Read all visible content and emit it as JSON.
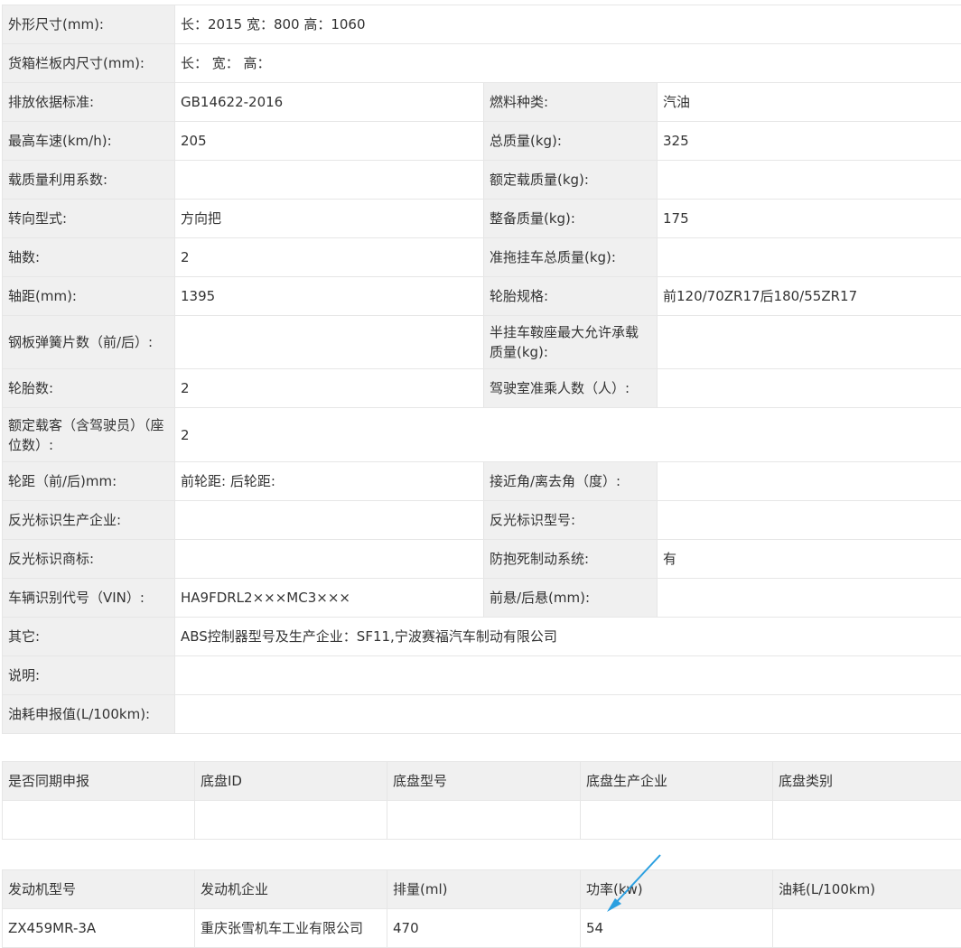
{
  "spec": {
    "dims_label": "外形尺寸(mm):",
    "dims_value": "长：2015 宽：800 高：1060",
    "cargo_label": "货箱栏板内尺寸(mm):",
    "cargo_value": "长： 宽： 高：",
    "emission_label": "排放依据标准:",
    "emission_value": "GB14622-2016",
    "fuel_label": "燃料种类:",
    "fuel_value": "汽油",
    "speed_label": "最高车速(km/h):",
    "speed_value": "205",
    "total_mass_label": "总质量(kg):",
    "total_mass_value": "325",
    "load_coef_label": "载质量利用系数:",
    "load_coef_value": "",
    "rated_load_label": "额定载质量(kg):",
    "rated_load_value": "",
    "steering_label": "转向型式:",
    "steering_value": "方向把",
    "curb_label": "整备质量(kg):",
    "curb_value": "175",
    "axles_label": "轴数:",
    "axles_value": "2",
    "trailer_label": "准拖挂车总质量(kg):",
    "trailer_value": "",
    "wheelbase_label": "轴距(mm):",
    "wheelbase_value": "1395",
    "tire_spec_label": "轮胎规格:",
    "tire_spec_value": "前120/70ZR17后180/55ZR17",
    "leaf_label": "钢板弹簧片数（前/后）:",
    "leaf_value": "",
    "saddle_label": "半挂车鞍座最大允许承载质量(kg):",
    "saddle_value": "",
    "tires_label": "轮胎数:",
    "tires_value": "2",
    "cab_label": "驾驶室准乘人数（人）:",
    "cab_value": "",
    "seats_label": "额定载客（含驾驶员）（座位数）:",
    "seats_value": "2",
    "track_label": "轮距（前/后)mm:",
    "track_value": "前轮距: 后轮距:",
    "angle_label": "接近角/离去角（度）:",
    "angle_value": "",
    "reflect_maker_label": "反光标识生产企业:",
    "reflect_maker_value": "",
    "reflect_model_label": "反光标识型号:",
    "reflect_model_value": "",
    "reflect_brand_label": "反光标识商标:",
    "reflect_brand_value": "",
    "abs_label": "防抱死制动系统:",
    "abs_value": "有",
    "vin_label": "车辆识别代号（VIN）:",
    "vin_value": "HA9FDRL2×××MC3×××",
    "overhang_label": "前悬/后悬(mm):",
    "overhang_value": "",
    "other_label": "其它:",
    "other_value": "ABS控制器型号及生产企业：SF11,宁波赛福汽车制动有限公司",
    "note_label": "说明:",
    "note_value": "",
    "fuel_use_label": "油耗申报值(L/100km):",
    "fuel_use_value": ""
  },
  "chassis": {
    "headers": [
      "是否同期申报",
      "底盘ID",
      "底盘型号",
      "底盘生产企业",
      "底盘类别"
    ],
    "row": [
      "",
      "",
      "",
      "",
      ""
    ]
  },
  "engine": {
    "headers": [
      "发动机型号",
      "发动机企业",
      "排量(ml)",
      "功率(kw)",
      "油耗(L/100km)"
    ],
    "row": [
      "ZX459MR-3A",
      "重庆张雪机车工业有限公司",
      "470",
      "54",
      ""
    ]
  },
  "annotation": {
    "arrow_color": "#2a9fe0"
  }
}
